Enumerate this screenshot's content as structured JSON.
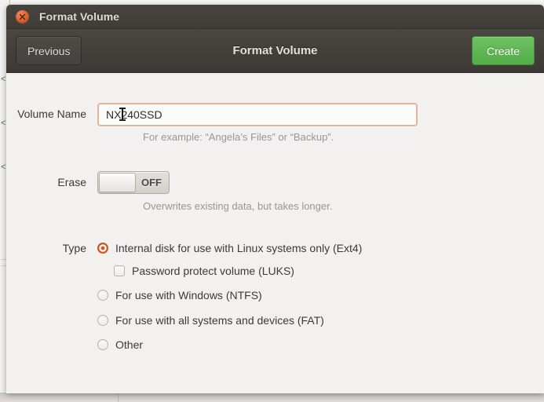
{
  "window": {
    "title": "Format Volume",
    "close_icon": "close-icon"
  },
  "headerbar": {
    "previous_label": "Previous",
    "title": "Format Volume",
    "create_label": "Create",
    "create_color": "#53ad49"
  },
  "form": {
    "volume_name": {
      "label": "Volume Name",
      "value": "NX240SSD",
      "placeholder": "",
      "hint": "For example: “Angela’s Files” or “Backup”.",
      "focus_border_color": "#e4b49a"
    },
    "erase": {
      "label": "Erase",
      "state": "OFF",
      "hint": "Overwrites existing data, but takes longer."
    },
    "type": {
      "label": "Type",
      "selected_index": 0,
      "accent_color": "#d9531b",
      "options": [
        {
          "label": "Internal disk for use with Linux systems only (Ext4)",
          "checked": true
        },
        {
          "label": "For use with Windows (NTFS)",
          "checked": false
        },
        {
          "label": "For use with all systems and devices (FAT)",
          "checked": false
        },
        {
          "label": "Other",
          "checked": false
        }
      ],
      "luks": {
        "label": "Password protect volume (LUKS)",
        "checked": false
      }
    }
  }
}
